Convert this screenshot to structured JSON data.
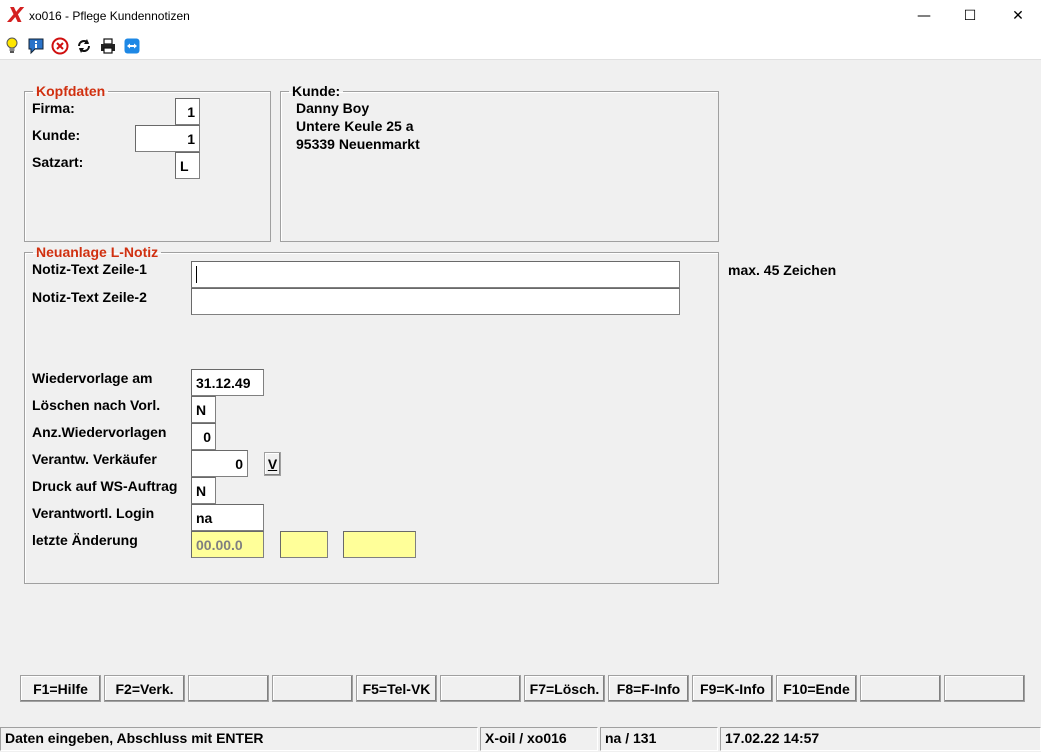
{
  "window": {
    "title": "xo016 - Pflege Kundennotizen",
    "app_icon_glyph": "X",
    "minimize_glyph": "—",
    "maximize_glyph": "☐",
    "close_glyph": "✕"
  },
  "toolbar": {
    "icons": [
      "lightbulb-icon",
      "info-icon",
      "cancel-icon",
      "refresh-icon",
      "print-icon",
      "teamviewer-icon"
    ]
  },
  "kopfdaten": {
    "legend": "Kopfdaten",
    "firma_label": "Firma:",
    "firma_value": "1",
    "kunde_label": "Kunde:",
    "kunde_value": "1",
    "satzart_label": "Satzart:",
    "satzart_value": "L"
  },
  "kunde": {
    "legend": "Kunde:",
    "name": "Danny Boy",
    "street": "Untere Keule 25 a",
    "city": "95339 Neuenmarkt"
  },
  "notiz": {
    "legend": "Neuanlage L-Notiz",
    "zeile1_label": "Notiz-Text Zeile-1",
    "zeile1_value": "",
    "zeile2_label": "Notiz-Text Zeile-2",
    "zeile2_value": "",
    "max_hint": "max. 45 Zeichen",
    "wiedervorlage_label": "Wiedervorlage am",
    "wiedervorlage_value": "31.12.49",
    "loeschen_label": "Löschen nach Vorl.",
    "loeschen_value": "N",
    "anz_label": "Anz.Wiedervorlagen",
    "anz_value": "0",
    "verkaeufer_label": "Verantw. Verkäufer",
    "verkaeufer_value": "0",
    "verkaeufer_btn": "V",
    "druck_label": "Druck auf WS-Auftrag",
    "druck_value": "N",
    "login_label": "Verantwortl. Login",
    "login_value": "na",
    "aenderung_label": "letzte Änderung",
    "aenderung_date": "00.00.0",
    "aenderung_b": "",
    "aenderung_c": ""
  },
  "fkeys": [
    "F1=Hilfe",
    "F2=Verk.",
    "",
    "",
    "F5=Tel-VK",
    "",
    "F7=Lösch.",
    "F8=F-Info",
    "F9=K-Info",
    "F10=Ende",
    "",
    ""
  ],
  "status": {
    "message": "Daten eingeben, Abschluss mit ENTER",
    "program": "X-oil / xo016",
    "user": "na / 131",
    "datetime": "17.02.22 14:57"
  },
  "colors": {
    "legend_red": "#d03010",
    "readonly_yellow": "#ffff99"
  }
}
